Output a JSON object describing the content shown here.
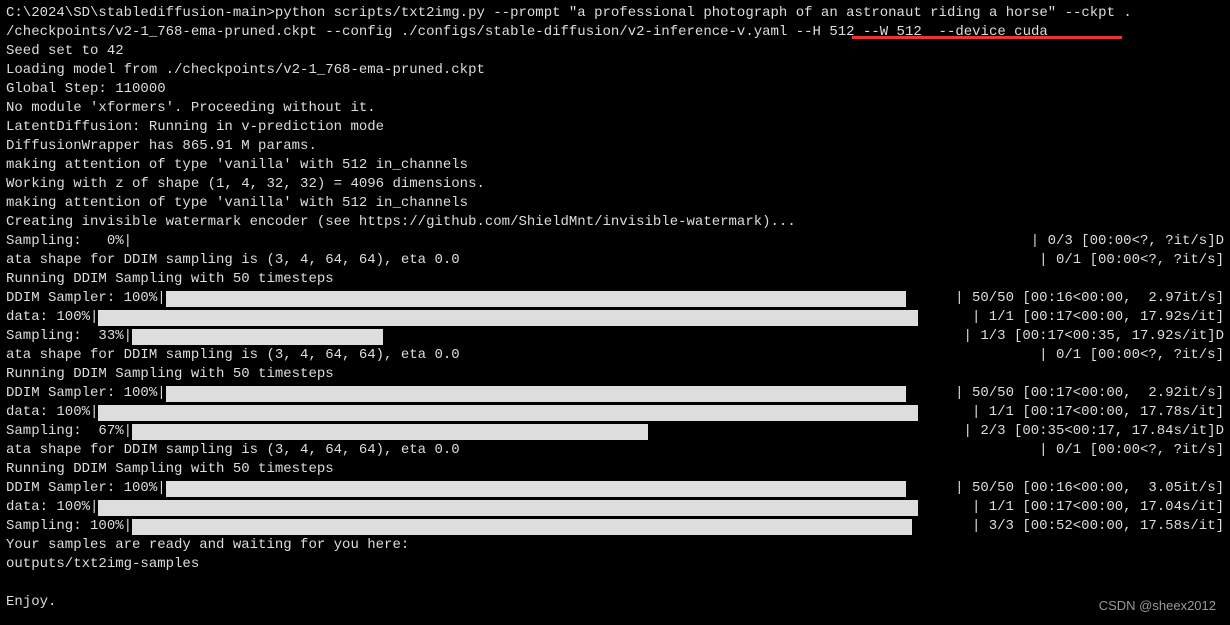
{
  "prompt_line1": "C:\\2024\\SD\\stablediffusion-main>python scripts/txt2img.py --prompt \"a professional photograph of an astronaut riding a horse\" --ckpt .",
  "prompt_line2": "/checkpoints/v2-1_768-ema-pruned.ckpt --config ./configs/stable-diffusion/v2-inference-v.yaml --H 512 --W 512  --device cuda",
  "log": [
    "Seed set to 42",
    "Loading model from ./checkpoints/v2-1_768-ema-pruned.ckpt",
    "Global Step: 110000",
    "No module 'xformers'. Proceeding without it.",
    "LatentDiffusion: Running in v-prediction mode",
    "DiffusionWrapper has 865.91 M params.",
    "making attention of type 'vanilla' with 512 in_channels",
    "Working with z of shape (1, 4, 32, 32) = 4096 dimensions.",
    "making attention of type 'vanilla' with 512 in_channels",
    "Creating invisible watermark encoder (see https://github.com/ShieldMnt/invisible-watermark)..."
  ],
  "progress": [
    {
      "label": "Sampling:   0%|",
      "bar_pct": 0,
      "track": 0,
      "stats": "| 0/3 [00:00<?, ?it/s]D"
    },
    {
      "plain": "ata shape for DDIM sampling is (3, 4, 64, 64), eta 0.0",
      "stats": "| 0/1 [00:00<?, ?it/s]"
    },
    {
      "plain": "Running DDIM Sampling with 50 timesteps"
    },
    {
      "label": "DDIM Sampler: 100%|",
      "bar_pct": 100,
      "track": 740,
      "stats": "| 50/50 [00:16<00:00,  2.97it/s]"
    },
    {
      "label": "data: 100%|",
      "bar_pct": 100,
      "track": 820,
      "stats": "| 1/1 [00:17<00:00, 17.92s/it]"
    },
    {
      "label": "Sampling:  33%|",
      "bar_pct": 33,
      "track": 760,
      "stats": "| 1/3 [00:17<00:35, 17.92s/it]D"
    },
    {
      "plain": "ata shape for DDIM sampling is (3, 4, 64, 64), eta 0.0",
      "stats": "| 0/1 [00:00<?, ?it/s]"
    },
    {
      "plain": "Running DDIM Sampling with 50 timesteps"
    },
    {
      "label": "DDIM Sampler: 100%|",
      "bar_pct": 100,
      "track": 740,
      "stats": "| 50/50 [00:17<00:00,  2.92it/s]"
    },
    {
      "label": "data: 100%|",
      "bar_pct": 100,
      "track": 820,
      "stats": "| 1/1 [00:17<00:00, 17.78s/it]"
    },
    {
      "label": "Sampling:  67%|",
      "bar_pct": 67,
      "track": 770,
      "stats": "| 2/3 [00:35<00:17, 17.84s/it]D"
    },
    {
      "plain": "ata shape for DDIM sampling is (3, 4, 64, 64), eta 0.0",
      "stats": "| 0/1 [00:00<?, ?it/s]"
    },
    {
      "plain": "Running DDIM Sampling with 50 timesteps"
    },
    {
      "label": "DDIM Sampler: 100%|",
      "bar_pct": 100,
      "track": 740,
      "stats": "| 50/50 [00:16<00:00,  3.05it/s]"
    },
    {
      "label": "data: 100%|",
      "bar_pct": 100,
      "track": 820,
      "stats": "| 1/1 [00:17<00:00, 17.04s/it]"
    },
    {
      "label": "Sampling: 100%|",
      "bar_pct": 100,
      "track": 780,
      "stats": "| 3/3 [00:52<00:00, 17.58s/it]"
    }
  ],
  "footer": [
    "Your samples are ready and waiting for you here:",
    "outputs/txt2img-samples",
    "",
    "Enjoy."
  ],
  "watermark": "CSDN @sheex2012"
}
